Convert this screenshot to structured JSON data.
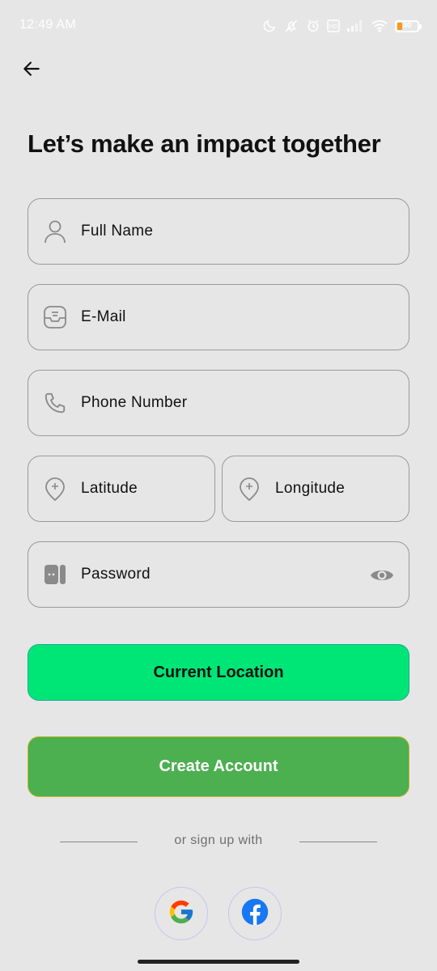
{
  "status_bar": {
    "time": "12:49 AM",
    "battery_level": "30",
    "icons": [
      "moon-icon",
      "mute-icon",
      "alarm-icon",
      "hd-icon",
      "signal-icon",
      "wifi-icon",
      "battery-icon"
    ]
  },
  "header": {
    "back_icon": "arrow-left-icon",
    "title": "Let’s make an impact together"
  },
  "form": {
    "full_name": {
      "placeholder": "Full Name",
      "icon": "person-icon"
    },
    "email": {
      "placeholder": "E-Mail",
      "icon": "inbox-icon"
    },
    "phone": {
      "placeholder": "Phone Number",
      "icon": "phone-icon"
    },
    "latitude": {
      "placeholder": "Latitude",
      "icon": "location-pin-icon"
    },
    "longitude": {
      "placeholder": "Longitude",
      "icon": "location-pin-icon"
    },
    "password": {
      "placeholder": "Password",
      "icon": "password-icon",
      "toggle_icon": "eye-icon"
    }
  },
  "buttons": {
    "current_location": "Current Location",
    "create_account": "Create Account"
  },
  "divider": {
    "text": "or sign up with"
  },
  "social": [
    {
      "name": "Google",
      "icon": "google-icon"
    },
    {
      "name": "Facebook",
      "icon": "facebook-icon"
    }
  ],
  "colors": {
    "background": "#e6e6e6",
    "location_button": "#00e676",
    "create_button": "#4caf50",
    "field_border": "#9a9a9a",
    "facebook_blue": "#1877f2"
  }
}
